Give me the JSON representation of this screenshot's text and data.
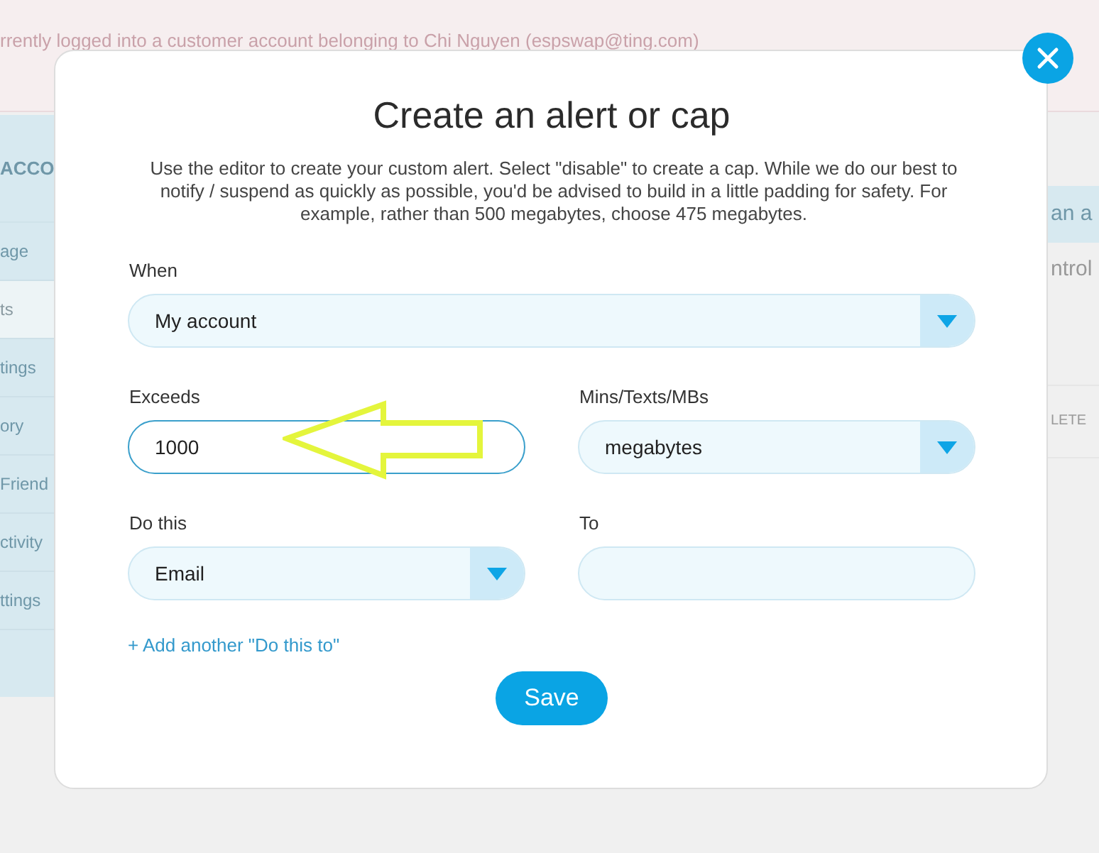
{
  "banner": {
    "text": "rrently logged into a customer account belonging to Chi Nguyen (espswap@ting.com)"
  },
  "sidebar": {
    "heading": "ACCO",
    "items": [
      {
        "label": "age",
        "selected": false
      },
      {
        "label": "ts",
        "selected": true
      },
      {
        "label": "tings",
        "selected": false
      },
      {
        "label": "ory",
        "selected": false
      },
      {
        "label": "Friend",
        "selected": false
      },
      {
        "label": "ctivity",
        "selected": false
      },
      {
        "label": "ttings",
        "selected": false
      }
    ]
  },
  "right_panel": {
    "heading": "an a",
    "text": "ntrol",
    "action": "LETE"
  },
  "dialog": {
    "title": "Create an alert or cap",
    "description": "Use the editor to create your custom alert. Select \"disable\" to create a cap. While we do our best to notify / suspend as quickly as possible, you'd be advised to build in a little padding for safety. For example, rather than 500 megabytes, choose 475 megabytes.",
    "rows": [
      [
        {
          "kind": "select",
          "label": "When",
          "value": "My account"
        }
      ],
      [
        {
          "kind": "input",
          "label": "Exceeds",
          "value": "1000",
          "focused": true
        },
        {
          "kind": "select",
          "label": "Mins/Texts/MBs",
          "value": "megabytes"
        }
      ],
      [
        {
          "kind": "select",
          "label": "Do this",
          "value": "Email"
        },
        {
          "kind": "input",
          "label": "To",
          "focused": false
        }
      ]
    ],
    "link": "+ Add another \"Do this to\"",
    "save_button": "Save"
  }
}
